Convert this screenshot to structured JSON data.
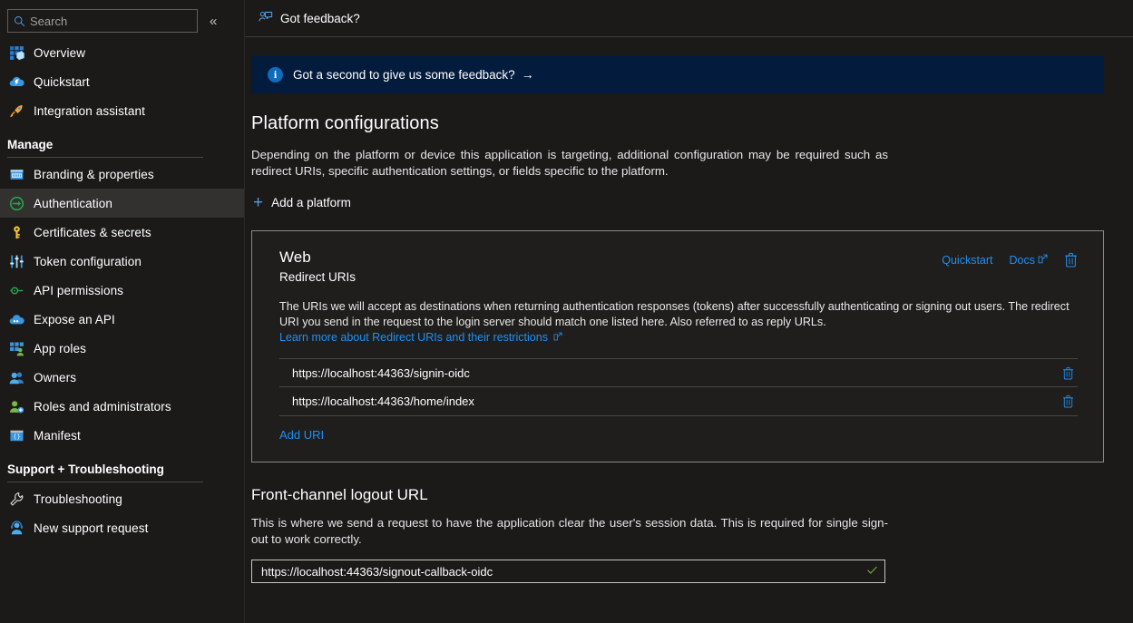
{
  "sidebar": {
    "search": {
      "placeholder": "Search",
      "value": ""
    },
    "collapse_label": "«",
    "items": [
      {
        "label": "Overview",
        "icon": "overview-icon",
        "selected": false
      },
      {
        "label": "Quickstart",
        "icon": "quickstart-icon",
        "selected": false
      },
      {
        "label": "Integration assistant",
        "icon": "integration-assistant-icon",
        "selected": false
      }
    ],
    "groups": [
      {
        "title": "Manage",
        "items": [
          {
            "label": "Branding & properties",
            "icon": "branding-icon",
            "selected": false
          },
          {
            "label": "Authentication",
            "icon": "authentication-icon",
            "selected": true
          },
          {
            "label": "Certificates & secrets",
            "icon": "key-icon",
            "selected": false
          },
          {
            "label": "Token configuration",
            "icon": "token-configuration-icon",
            "selected": false
          },
          {
            "label": "API permissions",
            "icon": "api-permissions-icon",
            "selected": false
          },
          {
            "label": "Expose an API",
            "icon": "expose-api-icon",
            "selected": false
          },
          {
            "label": "App roles",
            "icon": "app-roles-icon",
            "selected": false
          },
          {
            "label": "Owners",
            "icon": "owners-icon",
            "selected": false
          },
          {
            "label": "Roles and administrators",
            "icon": "roles-admins-icon",
            "selected": false
          },
          {
            "label": "Manifest",
            "icon": "manifest-icon",
            "selected": false
          }
        ]
      },
      {
        "title": "Support + Troubleshooting",
        "items": [
          {
            "label": "Troubleshooting",
            "icon": "wrench-icon",
            "selected": false
          },
          {
            "label": "New support request",
            "icon": "support-agent-icon",
            "selected": false
          }
        ]
      }
    ]
  },
  "commandbar": {
    "feedback": {
      "label": "Got feedback?",
      "icon": "feedback-person-icon"
    }
  },
  "banner": {
    "icon": "info-icon",
    "text": "Got a second to give us some feedback?",
    "arrow": "→"
  },
  "platform": {
    "title": "Platform configurations",
    "description": "Depending on the platform or device this application is targeting, additional configuration may be required such as redirect URIs, specific authentication settings, or fields specific to the platform.",
    "add_platform_label": "Add a platform",
    "add_platform_icon": "plus-icon"
  },
  "web_card": {
    "title": "Web",
    "subtitle": "Redirect URIs",
    "quickstart_label": "Quickstart",
    "docs_label": "Docs",
    "docs_icon": "external-link-icon",
    "delete_icon": "trash-icon",
    "description_part1": "The URIs we will accept as destinations when returning authentication responses (tokens) after successfully authenticating or signing out users. The redirect URI you send in the request to the login server should match one listed here. Also referred to as reply URLs. ",
    "learn_more_label": "Learn more about Redirect URIs and their restrictions",
    "uris": [
      {
        "value": "https://localhost:44363/signin-oidc",
        "delete_icon": "trash-icon"
      },
      {
        "value": "https://localhost:44363/home/index",
        "delete_icon": "trash-icon"
      }
    ],
    "add_uri_label": "Add URI"
  },
  "front_channel": {
    "title": "Front-channel logout URL",
    "description": "This is where we send a request to have the application clear the user's session data. This is required for single sign-out to work correctly.",
    "value": "https://localhost:44363/signout-callback-oidc",
    "placeholder": "e.g. https://example.com/logout",
    "valid_icon": "check-icon"
  },
  "colors": {
    "background": "#1b1a19",
    "card_background": "#1f1e1d",
    "banner_background": "#031b3d",
    "accent_link": "#1f8ff5",
    "selected_nav": "#323130",
    "valid_green": "#6fa83b"
  }
}
